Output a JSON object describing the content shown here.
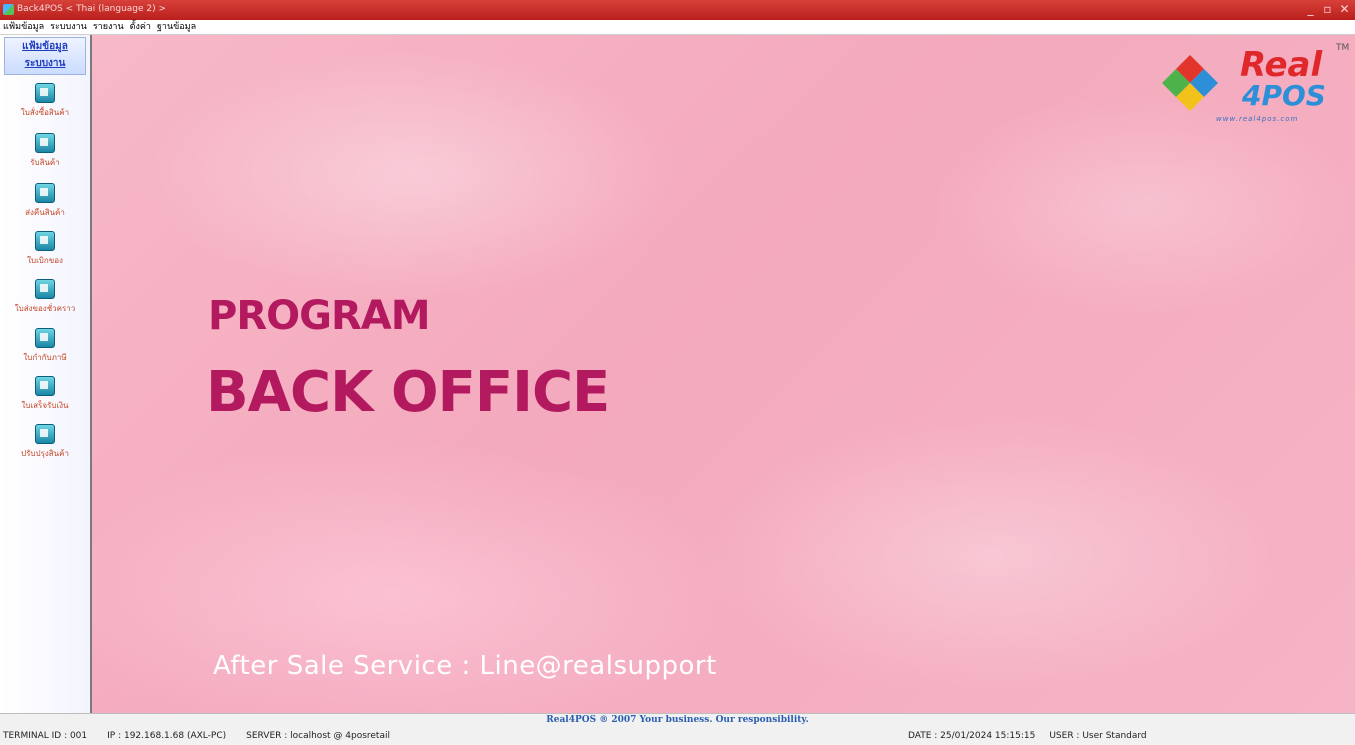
{
  "window": {
    "title": "Back4POS < Thai (language 2) >",
    "controls": [
      "minimize",
      "maximize",
      "close"
    ]
  },
  "menu": [
    "แฟ้มข้อมูล",
    "ระบบงาน",
    "รายงาน",
    "ตั้งค่า",
    "ฐานข้อมูล"
  ],
  "sidebar": {
    "header": [
      "แฟ้มข้อมูล",
      "ระบบงาน"
    ],
    "items": [
      {
        "label": "ใบสั่งซื้อสินค้า",
        "icon": "document-icon"
      },
      {
        "label": "รับสินค้า",
        "icon": "receive-goods-icon"
      },
      {
        "label": "ส่งคืนสินค้า",
        "icon": "return-goods-icon"
      },
      {
        "label": "ใบเบิกของ",
        "icon": "requisition-icon"
      },
      {
        "label": "ใบส่งของชั่วคราว",
        "icon": "delivery-person-icon"
      },
      {
        "label": "ใบกำกับภาษี",
        "icon": "tax-invoice-icon"
      },
      {
        "label": "ใบเสร็จรับเงิน",
        "icon": "receipt-icon"
      },
      {
        "label": "ปรับปรุงสินค้า",
        "icon": "adjust-stock-icon"
      }
    ]
  },
  "main": {
    "headline_line1": "PROGRAM",
    "headline_line2": "BACK OFFICE",
    "service": "After Sale Service : Line@realsupport"
  },
  "logo": {
    "real": "Real",
    "pos": "4POS",
    "tm": "TM",
    "website": "www.real4pos.com"
  },
  "status": {
    "center": "Real4POS ® 2007 Your business. Our responsibility.",
    "terminal": "TERMINAL ID : 001",
    "ip": "IP : 192.168.1.68 (AXL-PC)",
    "server": "SERVER : localhost @ 4posretail",
    "date": "DATE : 25/01/2024  15:15:15",
    "user": "USER : User Standard"
  },
  "colors": {
    "titlebar": "#c62a25",
    "headline": "#b3195e",
    "background": "#f4a9bd",
    "sidebar_label": "#c44a2a"
  }
}
